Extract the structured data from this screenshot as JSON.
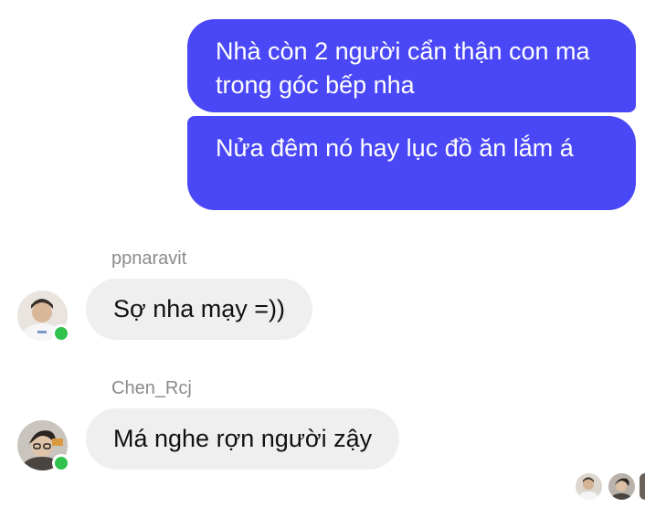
{
  "outgoing": [
    {
      "text": "Nhà còn 2 người cẩn thận con ma trong góc bếp nha"
    },
    {
      "text": "Nửa đêm nó hay lục đồ ăn lắm á"
    }
  ],
  "incoming": [
    {
      "sender": "ppnaravit",
      "text": "Sợ nha mạy =))",
      "online": true
    },
    {
      "sender": "Chen_Rcj",
      "text": "Má nghe rợn người zậy",
      "online": true
    }
  ],
  "colors": {
    "outgoing_bubble": "#4A48F6",
    "incoming_bubble": "#EFEFEF",
    "online_dot": "#31C24D",
    "sender_name": "#8a8a8a"
  },
  "icons": [
    "avatar",
    "online-status-icon",
    "seen-avatar"
  ]
}
